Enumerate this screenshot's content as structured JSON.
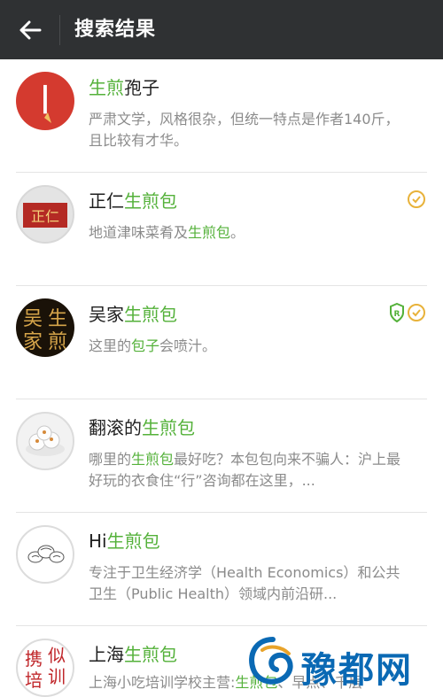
{
  "header": {
    "title": "搜索结果",
    "back_icon": "arrow-left-icon"
  },
  "results": [
    {
      "name_pre": "",
      "name_hl": "生煎",
      "name_post": "孢子",
      "desc_plain": "严肃文学，风格很杂，但统一特点是作者140斤，且比较有才华。",
      "badges": []
    },
    {
      "name_pre": "正仁",
      "name_hl": "生煎包",
      "name_post": "",
      "desc_pre": "地道津味菜肴及",
      "desc_hl": "生煎包",
      "desc_post": "。",
      "badges": [
        "verified"
      ]
    },
    {
      "name_pre": "吴家",
      "name_hl": "生煎包",
      "name_post": "",
      "desc_pre": "这里的",
      "desc_hl": "包子",
      "desc_post": "会喷汁。",
      "badges": [
        "registered-shield",
        "verified"
      ]
    },
    {
      "name_pre": "翻滚的",
      "name_hl": "生煎包",
      "name_post": "",
      "desc_pre": "哪里的",
      "desc_hl": "生煎包",
      "desc_post": "最好吃？本包包向来不骗人：沪上最好玩的衣食住“行”咨询都在这里，...",
      "badges": []
    },
    {
      "name_pre": "Hi",
      "name_hl": "生煎包",
      "name_post": "",
      "desc_plain": "专注于卫生经济学（Health Economics）和公共卫生（Public Health）领域内前沿研...",
      "badges": []
    },
    {
      "name_pre": "上海",
      "name_hl": "生煎包",
      "name_post": "",
      "desc_pre": "上海小吃培训学校主营:",
      "desc_hl": "生煎包",
      "desc_post": "、早点、千层",
      "badges": []
    }
  ],
  "avatars": {
    "a1": "丨",
    "a2": "正仁",
    "a3": [
      "吴",
      "生",
      "家",
      "煎"
    ],
    "a6": [
      "携",
      "似",
      "培",
      "训"
    ]
  },
  "watermark": {
    "text": "豫都网"
  },
  "colors": {
    "highlight": "#54b13a",
    "header_bg": "#2f3133",
    "badge": "#e8b23a"
  }
}
